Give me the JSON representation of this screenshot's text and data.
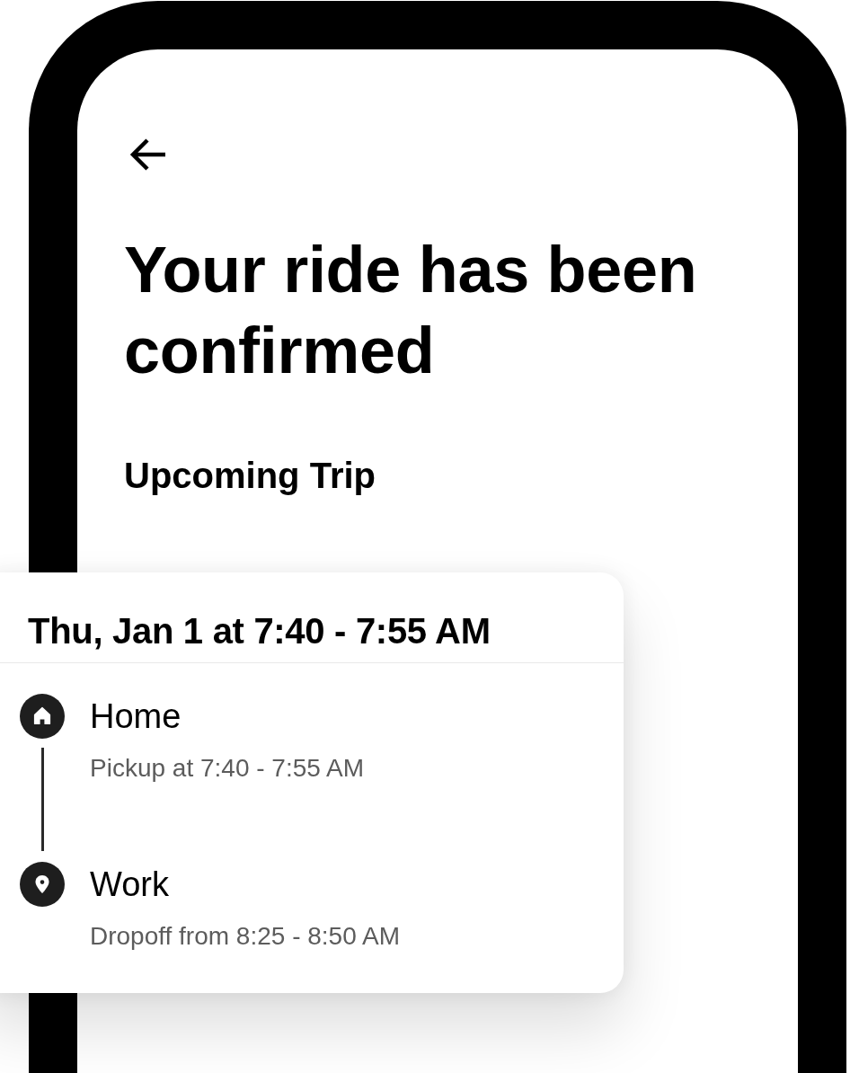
{
  "title": "Your ride has been confirmed",
  "section_title": "Upcoming Trip",
  "trip": {
    "time": "Thu, Jan 1 at 7:40 - 7:55 AM",
    "stops": [
      {
        "kind": "home",
        "name": "Home",
        "detail": "Pickup at 7:40 - 7:55 AM"
      },
      {
        "kind": "pin",
        "name": "Work",
        "detail": "Dropoff from 8:25 - 8:50 AM"
      }
    ]
  }
}
